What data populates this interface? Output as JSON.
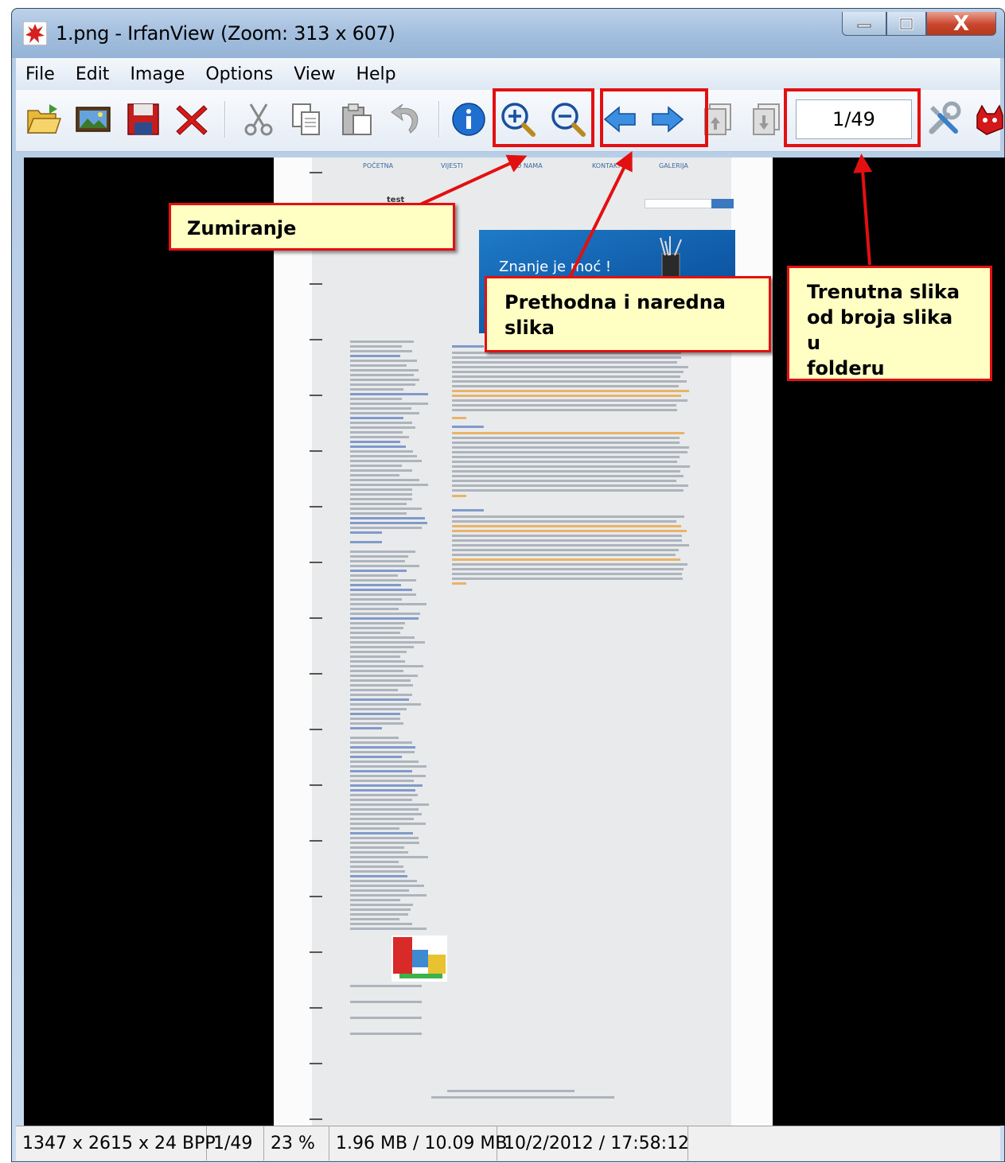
{
  "window": {
    "title": "1.png - IrfanView (Zoom: 313 x 607)",
    "close_label": "X"
  },
  "menu": [
    "File",
    "Edit",
    "Image",
    "Options",
    "View",
    "Help"
  ],
  "toolbar": {
    "icons": [
      "open-folder-icon",
      "thumbnails-icon",
      "save-icon",
      "delete-icon",
      "cut-icon",
      "copy-icon",
      "paste-icon",
      "undo-icon",
      "info-icon",
      "zoom-in-icon",
      "zoom-out-icon",
      "previous-image-icon",
      "next-image-icon",
      "first-page-icon",
      "next-page-icon",
      "settings-icon",
      "irfan-cat-icon"
    ],
    "page_counter": "1/49"
  },
  "document": {
    "nav_tabs": [
      "POČETNA",
      "VIJESTI",
      "O NAMA",
      "KONTAKT",
      "GALERIJA"
    ],
    "logo_text": "test",
    "banner_text": "Znanje je moć !"
  },
  "annotations": {
    "zoom": "Zumiranje",
    "prev_next": [
      "Prethodna i naredna",
      "slika"
    ],
    "current": [
      "Trenutna slika",
      "od broja slika u",
      "folderu"
    ]
  },
  "status": {
    "dimensions": "1347 x 2615 x 24 BPP",
    "index": "1/49",
    "zoom": "23 %",
    "size": "1.96 MB / 10.09 MB",
    "datetime": "10/2/2012 / 17:58:12"
  },
  "colors": {
    "annotation_red": "#e21010",
    "callout_fill": "#ffffc4",
    "viewer_background": "#000000"
  }
}
